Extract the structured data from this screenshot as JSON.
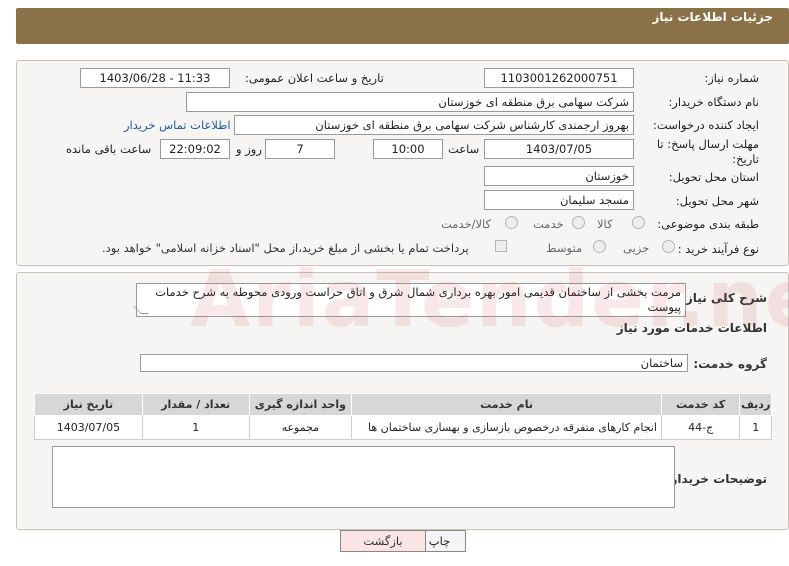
{
  "header": {
    "title": "جزئیات اطلاعات نیاز"
  },
  "details": {
    "need_number_label": "شماره نیاز:",
    "need_number": "1103001262000751",
    "announce_label": "تاریخ و ساعت اعلان عمومی:",
    "announce_value": "1403/06/28 - 11:33",
    "buyer_org_label": "نام دستگاه خریدار:",
    "buyer_org": "شرکت سهامی برق منطقه ای خوزستان",
    "creator_label": "ایجاد کننده درخواست:",
    "creator": "بهروز ارجمندی کارشناس شرکت سهامی برق منطقه ای خوزستان",
    "contact_link": "اطلاعات تماس خریدار",
    "deadline_label": "مهلت ارسال پاسخ: تا تاریخ:",
    "deadline_date": "1403/07/05",
    "time_label": "ساعت",
    "deadline_time": "10:00",
    "days_value": "7",
    "days_label": "روز و",
    "remaining_time": "22:09:02",
    "remaining_label": "ساعت باقی مانده",
    "province_label": "استان محل تحویل:",
    "province": "خوزستان",
    "city_label": "شهر محل تحویل:",
    "city": "مسجد سلیمان",
    "category_label": "طبقه بندی موضوعی:",
    "category_options": [
      "کالا",
      "خدمت",
      "کالا/خدمت"
    ],
    "process_label": "نوع فرآیند خرید :",
    "process_options": [
      "جزیی",
      "متوسط"
    ],
    "payment_note": "پرداخت تمام یا بخشی از مبلغ خرید،از محل \"اسناد خزانه اسلامی\" خواهد بود."
  },
  "summary": {
    "label": "شرح کلی نیاز:",
    "text": "مرمت بخشی از ساختمان قدیمی امور بهره برداری شمال شرق و اتاق حراست ورودی محوطه به شرح خدمات پیوست",
    "services_heading": "اطلاعات خدمات مورد نیاز",
    "group_label": "گروه خدمت:",
    "group_value": "ساختمان"
  },
  "table": {
    "headers": [
      "ردیف",
      "کد خدمت",
      "نام خدمت",
      "واحد اندازه گیری",
      "تعداد / مقدار",
      "تاریخ نیاز"
    ],
    "rows": [
      [
        "1",
        "ج-44",
        "انجام کارهای متفرقه درخصوص بازسازی و بهسازی ساختمان ها",
        "مجموعه",
        "1",
        "1403/07/05"
      ]
    ]
  },
  "buyer_notes": {
    "label": "توضیحات خریدار:",
    "value": ""
  },
  "buttons": {
    "print": "چاپ",
    "back": "بازگشت"
  },
  "watermark": "AriaTender.neT"
}
